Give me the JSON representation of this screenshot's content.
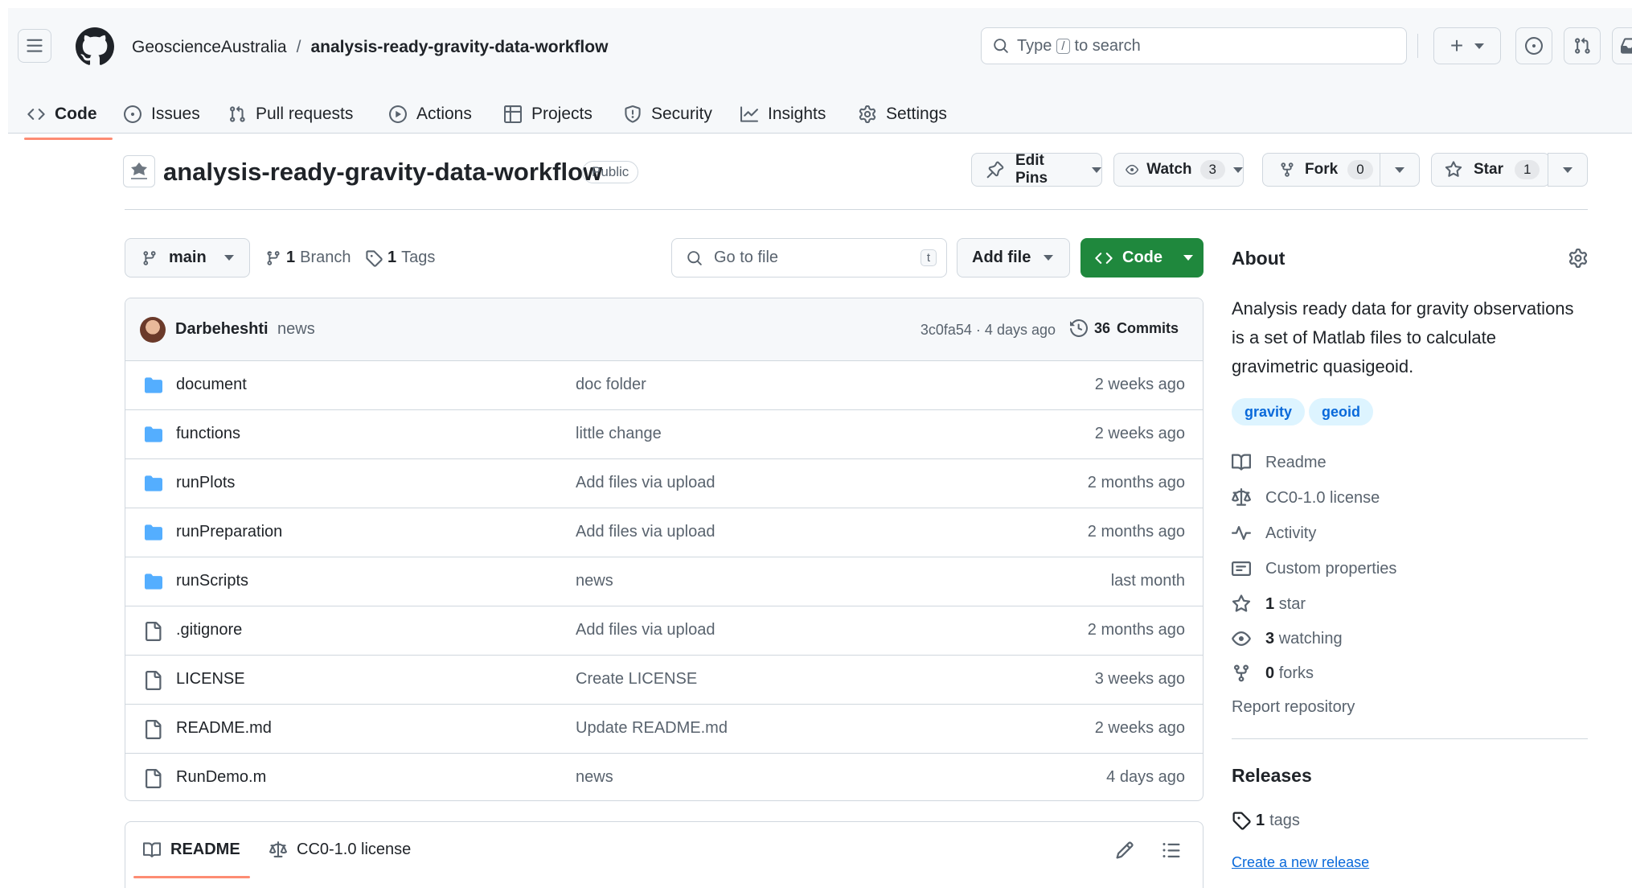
{
  "header": {
    "owner": "GeoscienceAustralia",
    "separator": "/",
    "repo": "analysis-ready-gravity-data-workflow",
    "search_placeholder_prefix": "Type",
    "search_key": "/",
    "search_placeholder_suffix": "to search",
    "plus": "+"
  },
  "nav_tabs": [
    {
      "label": "Code"
    },
    {
      "label": "Issues"
    },
    {
      "label": "Pull requests"
    },
    {
      "label": "Actions"
    },
    {
      "label": "Projects"
    },
    {
      "label": "Security"
    },
    {
      "label": "Insights"
    },
    {
      "label": "Settings"
    }
  ],
  "repo_head": {
    "title": "analysis-ready-gravity-data-workflow",
    "visibility": "Public",
    "edit_pins": "Edit Pins",
    "watch": "Watch",
    "watch_count": "3",
    "fork": "Fork",
    "fork_count": "0",
    "star": "Star",
    "star_count": "1"
  },
  "toolbar": {
    "branch": "main",
    "branches_count": "1",
    "branches_label": "Branch",
    "tags_count": "1",
    "tags_label": "Tags",
    "go_to_file_placeholder": "Go to file",
    "go_to_file_key": "t",
    "add_file": "Add file",
    "code": "Code"
  },
  "commit": {
    "author": "Darbeheshti",
    "message": "news",
    "hash_age": "3c0fa54 · 4 days ago",
    "commits_count": "36",
    "commits_label": "Commits"
  },
  "files": [
    {
      "type": "folder",
      "name": "document",
      "message": "doc folder",
      "age": "2 weeks ago"
    },
    {
      "type": "folder",
      "name": "functions",
      "message": "little change",
      "age": "2 weeks ago"
    },
    {
      "type": "folder",
      "name": "runPlots",
      "message": "Add files via upload",
      "age": "2 months ago"
    },
    {
      "type": "folder",
      "name": "runPreparation",
      "message": "Add files via upload",
      "age": "2 months ago"
    },
    {
      "type": "folder",
      "name": "runScripts",
      "message": "news",
      "age": "last month"
    },
    {
      "type": "file",
      "name": ".gitignore",
      "message": "Add files via upload",
      "age": "2 months ago"
    },
    {
      "type": "file",
      "name": "LICENSE",
      "message": "Create LICENSE",
      "age": "3 weeks ago"
    },
    {
      "type": "file",
      "name": "README.md",
      "message": "Update README.md",
      "age": "2 weeks ago"
    },
    {
      "type": "file",
      "name": "RunDemo.m",
      "message": "news",
      "age": "4 days ago"
    }
  ],
  "readme_tabs": {
    "readme": "README",
    "license": "CC0-1.0 license"
  },
  "about": {
    "heading": "About",
    "description": "Analysis ready data for gravity observations is a set of Matlab files to calculate gravimetric quasigeoid.",
    "topics": [
      "gravity",
      "geoid"
    ],
    "links": {
      "readme": "Readme",
      "license": "CC0-1.0 license",
      "activity": "Activity",
      "custom_properties": "Custom properties",
      "stars_count": "1",
      "stars_label": "star",
      "watching_count": "3",
      "watching_label": "watching",
      "forks_count": "0",
      "forks_label": "forks"
    },
    "report": "Report repository"
  },
  "releases": {
    "heading": "Releases",
    "tags_count": "1",
    "tags_label": "tags",
    "create_link": "Create a new release"
  },
  "colors": {
    "accent_green": "#1f883d",
    "link_blue": "#0969da",
    "folder_blue": "#54aeff",
    "tab_underline": "#fd8c73"
  }
}
